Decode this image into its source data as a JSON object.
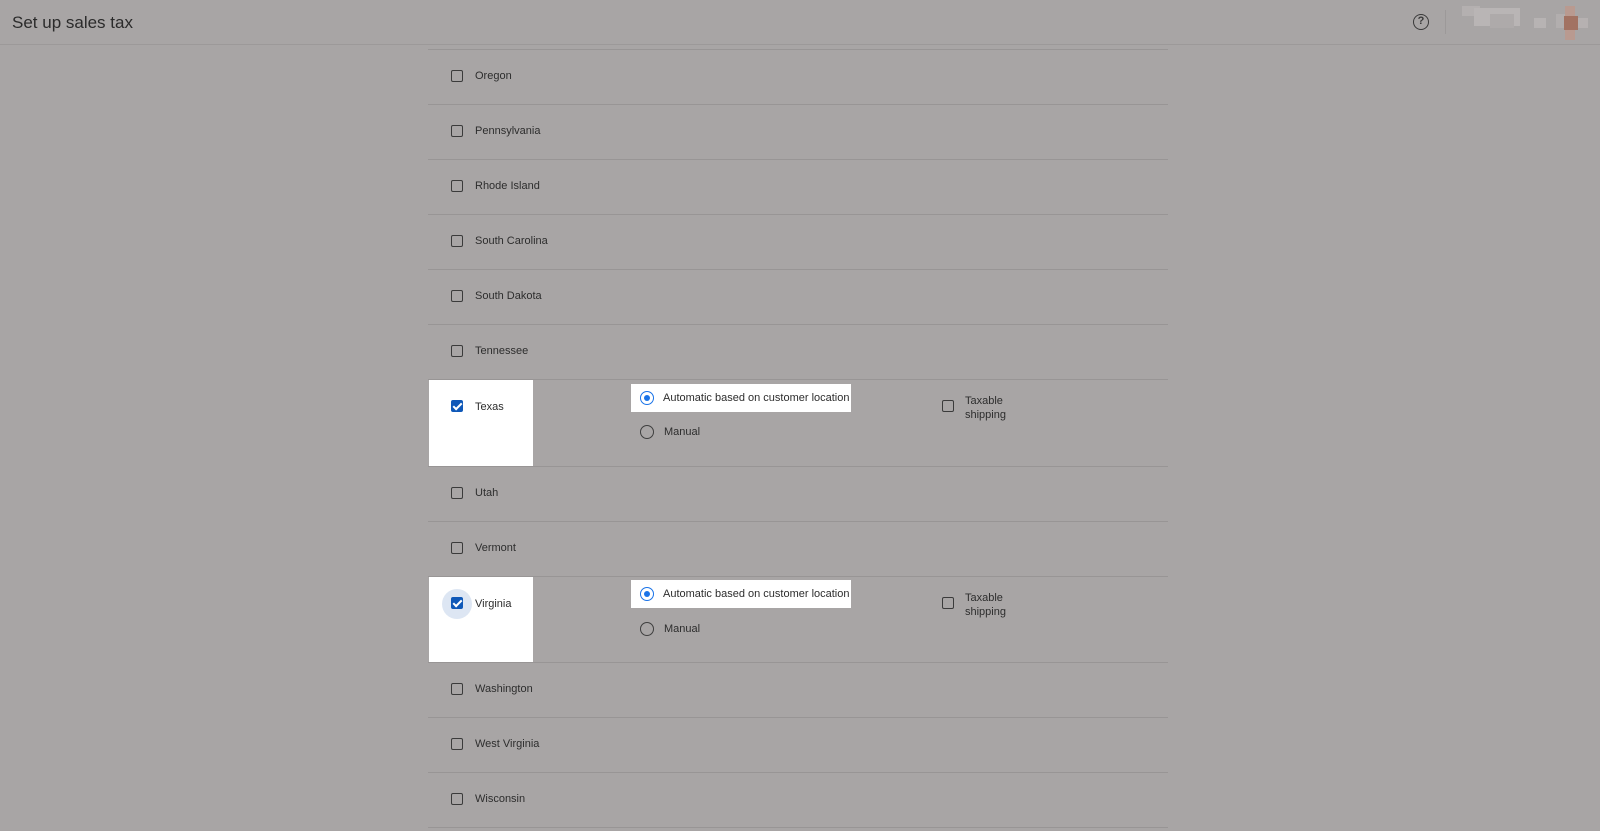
{
  "header": {
    "title": "Set up sales tax",
    "help_icon": "help-circle-icon",
    "help_glyph": "?"
  },
  "states": [
    {
      "name": "Oregon",
      "checked": false
    },
    {
      "name": "Pennsylvania",
      "checked": false
    },
    {
      "name": "Rhode Island",
      "checked": false
    },
    {
      "name": "South Carolina",
      "checked": false
    },
    {
      "name": "South Dakota",
      "checked": false
    },
    {
      "name": "Tennessee",
      "checked": false
    },
    {
      "name": "Texas",
      "checked": true,
      "tax_mode": "Automatic based on customer location",
      "taxable_shipping": false
    },
    {
      "name": "Utah",
      "checked": false
    },
    {
      "name": "Vermont",
      "checked": false
    },
    {
      "name": "Virginia",
      "checked": true,
      "tax_mode": "Automatic based on customer location",
      "taxable_shipping": false
    },
    {
      "name": "Washington",
      "checked": false
    },
    {
      "name": "West Virginia",
      "checked": false
    },
    {
      "name": "Wisconsin",
      "checked": false
    }
  ],
  "options": {
    "automatic_label": "Automatic based on customer location",
    "manual_label": "Manual",
    "taxable_shipping_label": "Taxable shipping"
  },
  "colors": {
    "overlay": "#a8a5a5",
    "checkbox_checked": "#0f58b8",
    "radio_selected": "#1a73e8"
  }
}
